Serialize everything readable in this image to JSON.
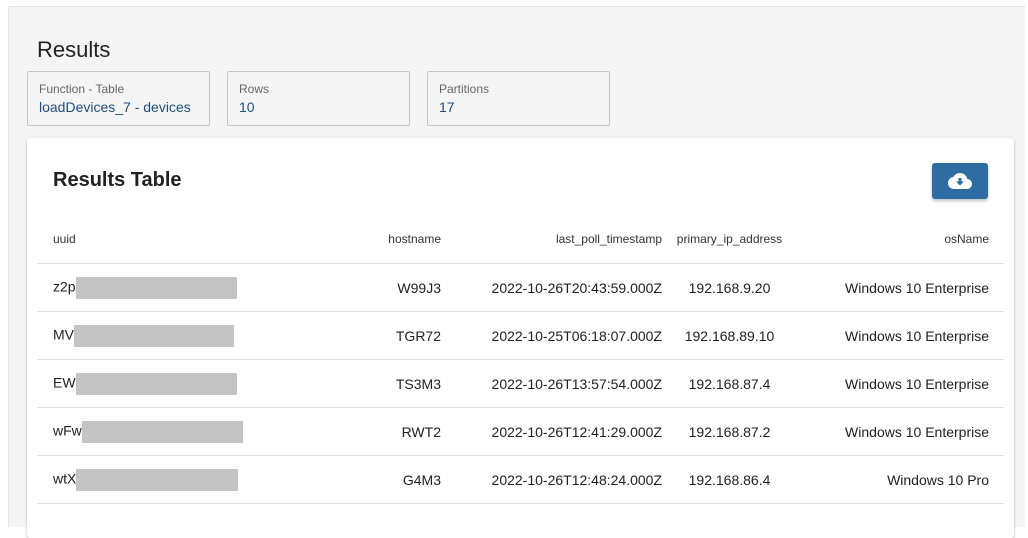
{
  "page": {
    "title": "Results"
  },
  "info_cards": {
    "function": {
      "label": "Function - Table",
      "value": "loadDevices_7 - devices"
    },
    "rows": {
      "label": "Rows",
      "value": "10"
    },
    "partitions": {
      "label": "Partitions",
      "value": "17"
    }
  },
  "results_panel": {
    "title": "Results Table",
    "download_icon": "cloud-download-icon"
  },
  "table": {
    "headers": {
      "uuid": "uuid",
      "hostname": "hostname",
      "last_poll_timestamp": "last_poll_timestamp",
      "primary_ip_address": "primary_ip_address",
      "osName": "osName"
    },
    "rows": [
      {
        "uuid": "z2p",
        "hostname": "W99J3",
        "last_poll_timestamp": "2022-10-26T20:43:59.000Z",
        "primary_ip_address": "192.168.9.20",
        "osName": "Windows 10 Enterprise"
      },
      {
        "uuid": "MV",
        "hostname": "TGR72",
        "last_poll_timestamp": "2022-10-25T06:18:07.000Z",
        "primary_ip_address": "192.168.89.10",
        "osName": "Windows 10 Enterprise"
      },
      {
        "uuid": "EW",
        "hostname": "TS3M3",
        "last_poll_timestamp": "2022-10-26T13:57:54.000Z",
        "primary_ip_address": "192.168.87.4",
        "osName": "Windows 10 Enterprise"
      },
      {
        "uuid": "wFw",
        "hostname": "RWT2",
        "last_poll_timestamp": "2022-10-26T12:41:29.000Z",
        "primary_ip_address": "192.168.87.2",
        "osName": "Windows 10 Enterprise"
      },
      {
        "uuid": "wtX",
        "hostname": "G4M3",
        "last_poll_timestamp": "2022-10-26T12:48:24.000Z",
        "primary_ip_address": "192.168.86.4",
        "osName": "Windows 10 Pro"
      }
    ]
  },
  "colors": {
    "accent": "#2e6da4",
    "value_text": "#1f4e79",
    "redaction": "#c4c4c4"
  }
}
